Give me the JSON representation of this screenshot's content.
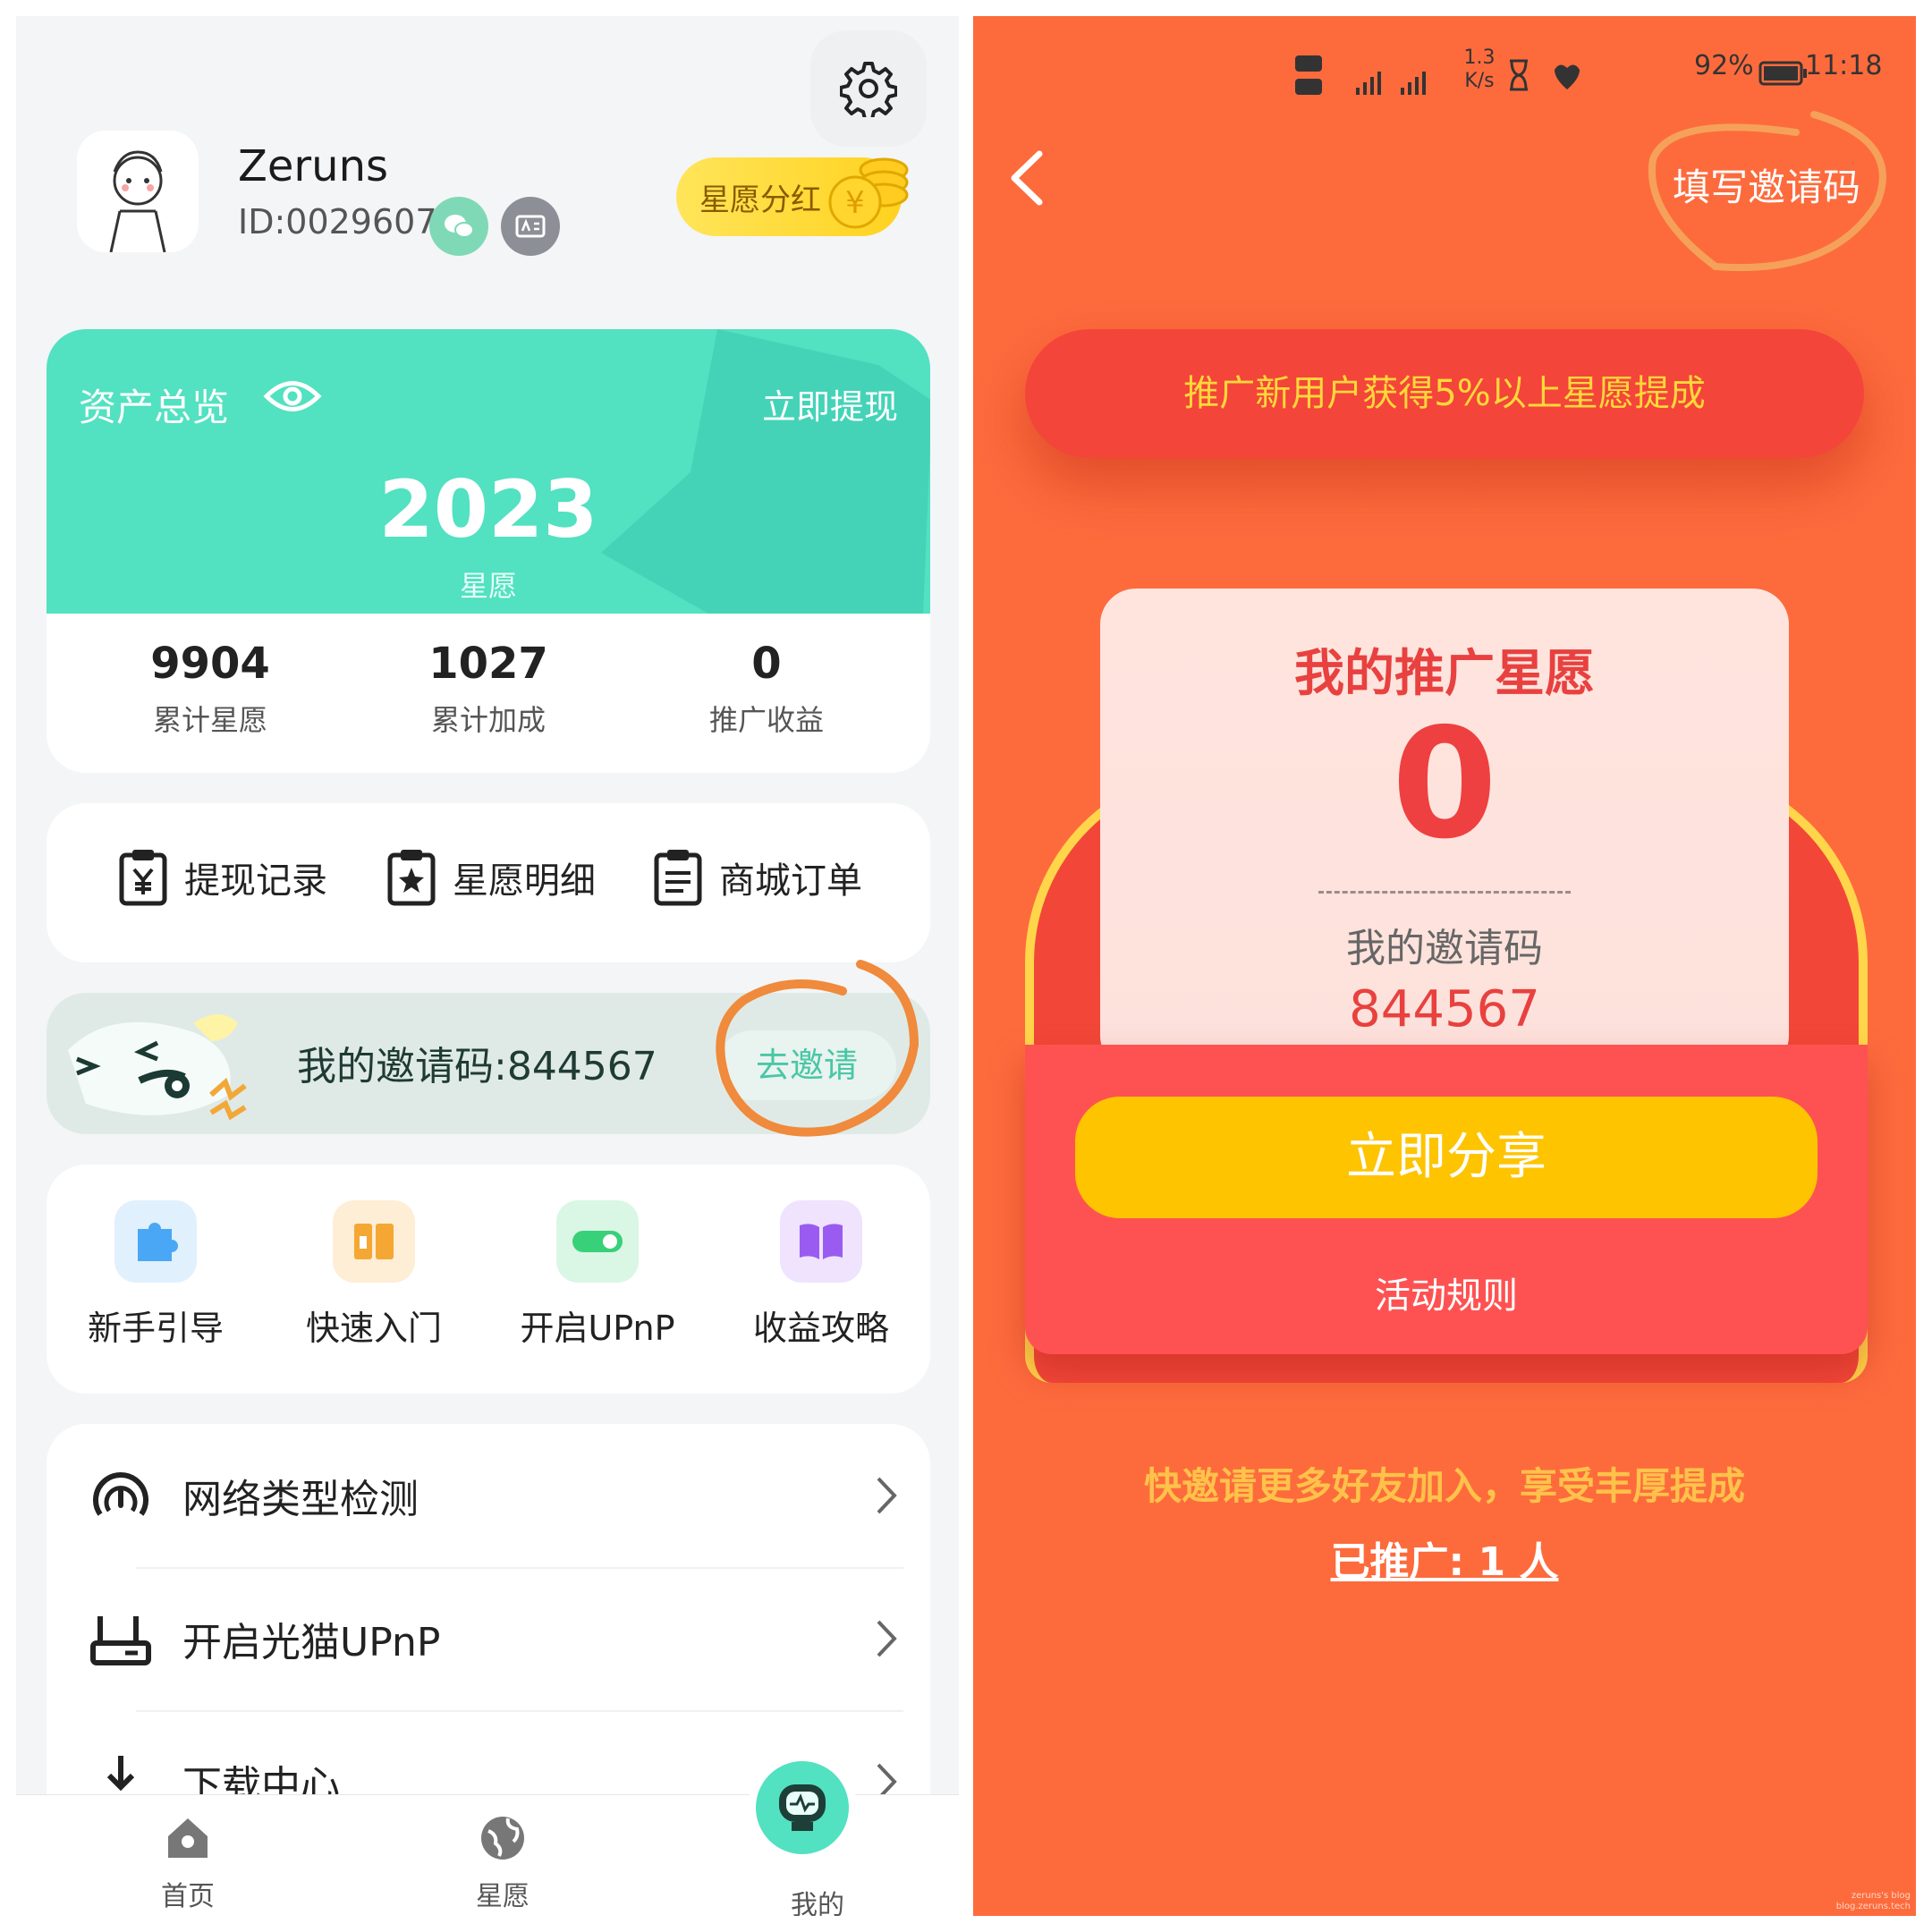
{
  "left": {
    "user": {
      "name": "Zeruns",
      "id": "ID:0029607"
    },
    "bonus_badge": "星愿分红",
    "asset": {
      "title": "资产总览",
      "withdraw": "立即提现",
      "amount": "2023",
      "unit": "星愿",
      "stats": [
        {
          "value": "9904",
          "label": "累计星愿"
        },
        {
          "value": "1027",
          "label": "累计加成"
        },
        {
          "value": "0",
          "label": "推广收益"
        }
      ]
    },
    "quick_links": [
      {
        "label": "提现记录",
        "icon": "yen-clipboard-icon"
      },
      {
        "label": "星愿明细",
        "icon": "star-clipboard-icon"
      },
      {
        "label": "商城订单",
        "icon": "list-clipboard-icon"
      }
    ],
    "invite": {
      "text": "我的邀请码:844567",
      "button": "去邀请"
    },
    "tools": [
      {
        "label": "新手引导",
        "icon": "puzzle-icon",
        "color": "#4aa7f5"
      },
      {
        "label": "快速入门",
        "icon": "door-icon",
        "color": "#f5a733"
      },
      {
        "label": "开启UPnP",
        "icon": "toggle-icon",
        "color": "#39d07a"
      },
      {
        "label": "收益攻略",
        "icon": "book-icon",
        "color": "#9a5cf0"
      }
    ],
    "menu": [
      {
        "label": "网络类型检测",
        "icon": "speedometer-icon"
      },
      {
        "label": "开启光猫UPnP",
        "icon": "router-icon"
      },
      {
        "label": "下载中心",
        "icon": "download-icon"
      }
    ],
    "tabs": [
      {
        "label": "首页",
        "icon": "home-icon"
      },
      {
        "label": "星愿",
        "icon": "globe-icon"
      },
      {
        "label": "我的",
        "icon": "robot-icon"
      }
    ],
    "accent": "#52e1c1"
  },
  "right": {
    "status": {
      "network": "1.3 K/s",
      "battery": "92%",
      "time": "11:18"
    },
    "fill_code": "填写邀请码",
    "banner": "推广新用户获得5%以上星愿提成",
    "card": {
      "title": "我的推广星愿",
      "value": "0",
      "code_label": "我的邀请码",
      "code": "844567"
    },
    "share_button": "立即分享",
    "rules": "活动规则",
    "promo": "快邀请更多好友加入，享受丰厚提成",
    "promoted": "已推广: 1 人",
    "watermark": [
      "zeruns's blog",
      "blog.zeruns.tech"
    ],
    "bg": "#fd6b3d"
  }
}
